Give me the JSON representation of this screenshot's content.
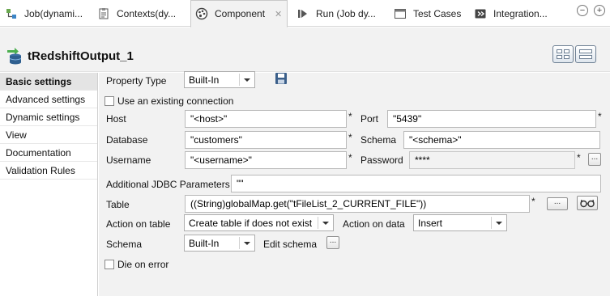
{
  "tabs": [
    {
      "label": "Job(dynami...",
      "icon": "job-icon"
    },
    {
      "label": "Contexts(dy...",
      "icon": "contexts-icon"
    },
    {
      "label": "Component",
      "icon": "palette-icon",
      "active": true
    },
    {
      "label": "Run (Job dy...",
      "icon": "run-icon"
    },
    {
      "label": "Test Cases",
      "icon": "test-cases-icon"
    },
    {
      "label": "Integration...",
      "icon": "integration-icon"
    }
  ],
  "window_controls": {
    "minimize": "−",
    "maximize": "+"
  },
  "component": {
    "title": "tRedshiftOutput_1"
  },
  "nav": [
    {
      "label": "Basic settings",
      "active": true
    },
    {
      "label": "Advanced settings"
    },
    {
      "label": "Dynamic settings"
    },
    {
      "label": "View"
    },
    {
      "label": "Documentation"
    },
    {
      "label": "Validation Rules"
    }
  ],
  "form": {
    "property_type_label": "Property Type",
    "property_type_value": "Built-In",
    "use_existing_label": "Use an existing connection",
    "host_label": "Host",
    "host_value": "\"<host>\"",
    "port_label": "Port",
    "port_value": "\"5439\"",
    "database_label": "Database",
    "database_value": "\"customers\"",
    "schema_label": "Schema",
    "schema_value": "\"<schema>\"",
    "username_label": "Username",
    "username_value": "\"<username>\"",
    "password_label": "Password",
    "password_value": "****",
    "jdbc_label": "Additional JDBC Parameters",
    "jdbc_value": "\"\"",
    "table_label": "Table",
    "table_value": "((String)globalMap.get(\"tFileList_2_CURRENT_FILE\"))",
    "action_table_label": "Action on table",
    "action_table_value": "Create table if does not exist",
    "action_data_label": "Action on data",
    "action_data_value": "Insert",
    "schema2_label": "Schema",
    "schema2_value": "Built-In",
    "edit_schema_label": "Edit schema",
    "die_on_error_label": "Die on error",
    "required_mark": "*",
    "ellipsis": "..."
  }
}
